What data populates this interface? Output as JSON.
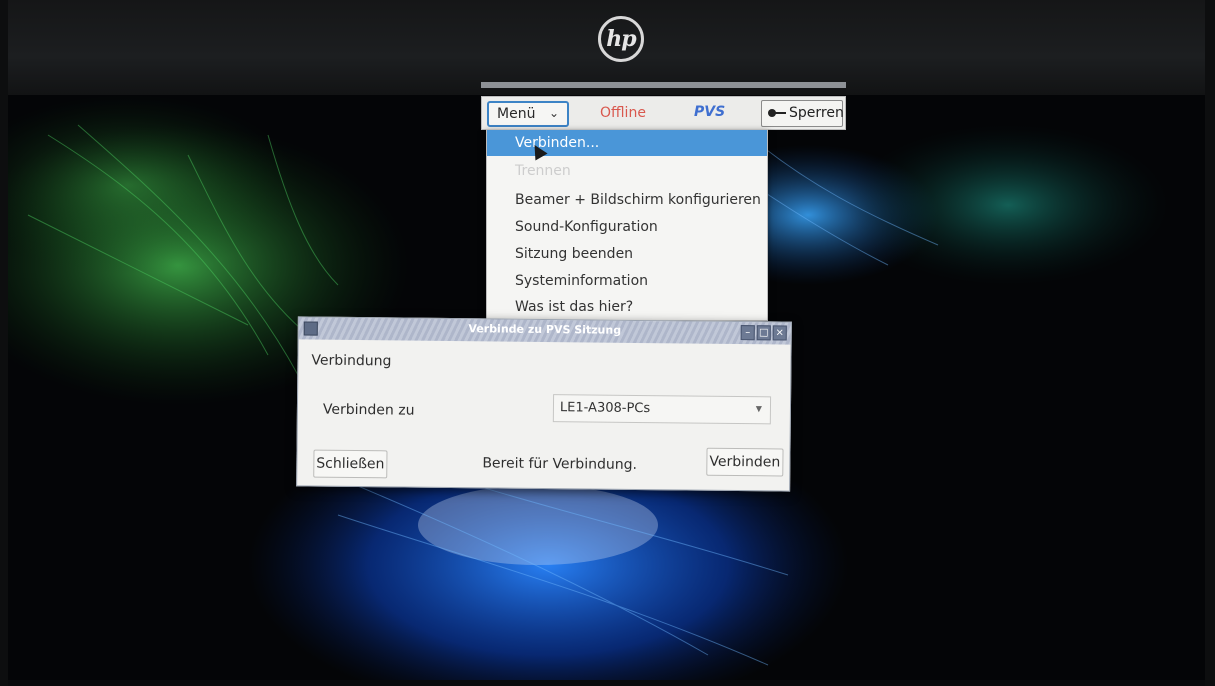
{
  "device": {
    "brand": "hp"
  },
  "pvs_bar": {
    "menu_label": "Menü",
    "status": "Offline",
    "app_label": "PVS",
    "lock_label": "Sperren"
  },
  "menu": {
    "items": [
      {
        "label": "Verbinden...",
        "state": "active"
      },
      {
        "label": "Trennen",
        "state": "disabled"
      },
      {
        "label": "Beamer + Bildschirm konfigurieren",
        "state": "normal"
      },
      {
        "label": "Sound-Konfiguration",
        "state": "normal"
      },
      {
        "label": "Sitzung beenden",
        "state": "normal"
      },
      {
        "label": "Systeminformation",
        "state": "normal"
      },
      {
        "label": "Was ist das hier?",
        "state": "normal"
      }
    ]
  },
  "dialog": {
    "title": "Verbinde zu PVS Sitzung",
    "section_label": "Verbindung",
    "connect_to_label": "Verbinden zu",
    "connect_to_value": "LE1-A308-PCs",
    "status_text": "Bereit für Verbindung.",
    "close_button": "Schließen",
    "connect_button": "Verbinden"
  },
  "colors": {
    "accent": "#4a96d8",
    "offline": "#d9584e",
    "pvs": "#3f6fd0"
  }
}
